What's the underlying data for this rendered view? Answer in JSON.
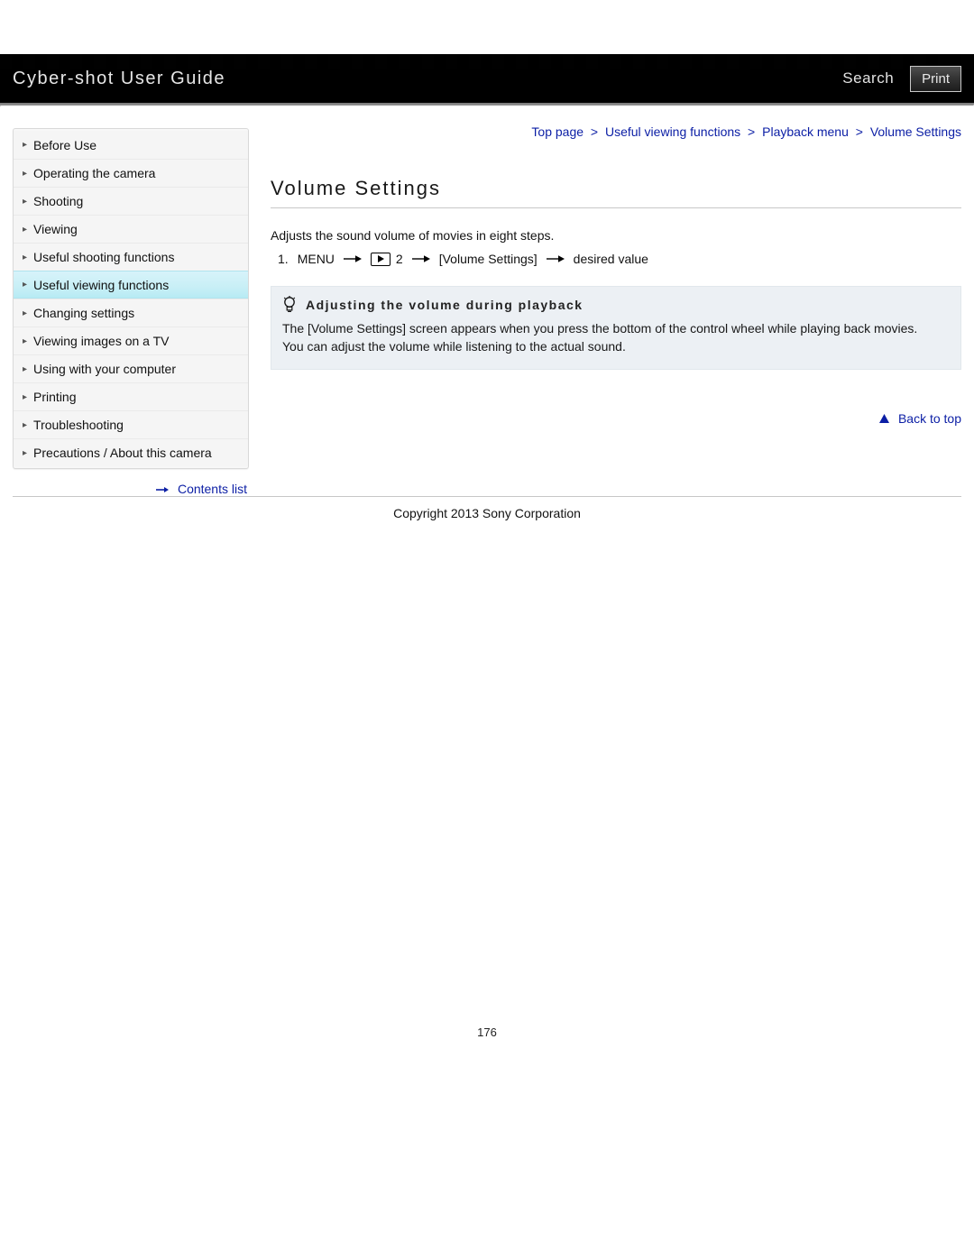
{
  "header": {
    "title": "Cyber-shot User Guide",
    "search": "Search",
    "print": "Print"
  },
  "sidebar": {
    "items": [
      {
        "label": "Before Use"
      },
      {
        "label": "Operating the camera"
      },
      {
        "label": "Shooting"
      },
      {
        "label": "Viewing"
      },
      {
        "label": "Useful shooting functions"
      },
      {
        "label": "Useful viewing functions",
        "active": true
      },
      {
        "label": "Changing settings"
      },
      {
        "label": "Viewing images on a TV"
      },
      {
        "label": "Using with your computer"
      },
      {
        "label": "Printing"
      },
      {
        "label": "Troubleshooting"
      },
      {
        "label": "Precautions / About this camera"
      }
    ],
    "contents_list": "Contents list"
  },
  "breadcrumb": {
    "items": [
      {
        "label": "Top page"
      },
      {
        "label": "Useful viewing functions"
      },
      {
        "label": "Playback menu"
      }
    ],
    "current": "Volume Settings",
    "sep": ">"
  },
  "content": {
    "title": "Volume Settings",
    "intro": "Adjusts the sound volume of movies in eight steps.",
    "step": {
      "num": "1.",
      "seg1": "MENU",
      "play_suffix": "2",
      "seg2": "[Volume Settings]",
      "seg3": "desired value"
    },
    "tip": {
      "heading": "Adjusting the volume during playback",
      "body1": "The [Volume Settings] screen appears when you press the bottom of the control wheel while playing back movies.",
      "body2": "You can adjust the volume while listening to the actual sound."
    },
    "back_to_top": "Back to top"
  },
  "footer": {
    "copyright": "Copyright 2013 Sony Corporation",
    "page_number": "176"
  }
}
